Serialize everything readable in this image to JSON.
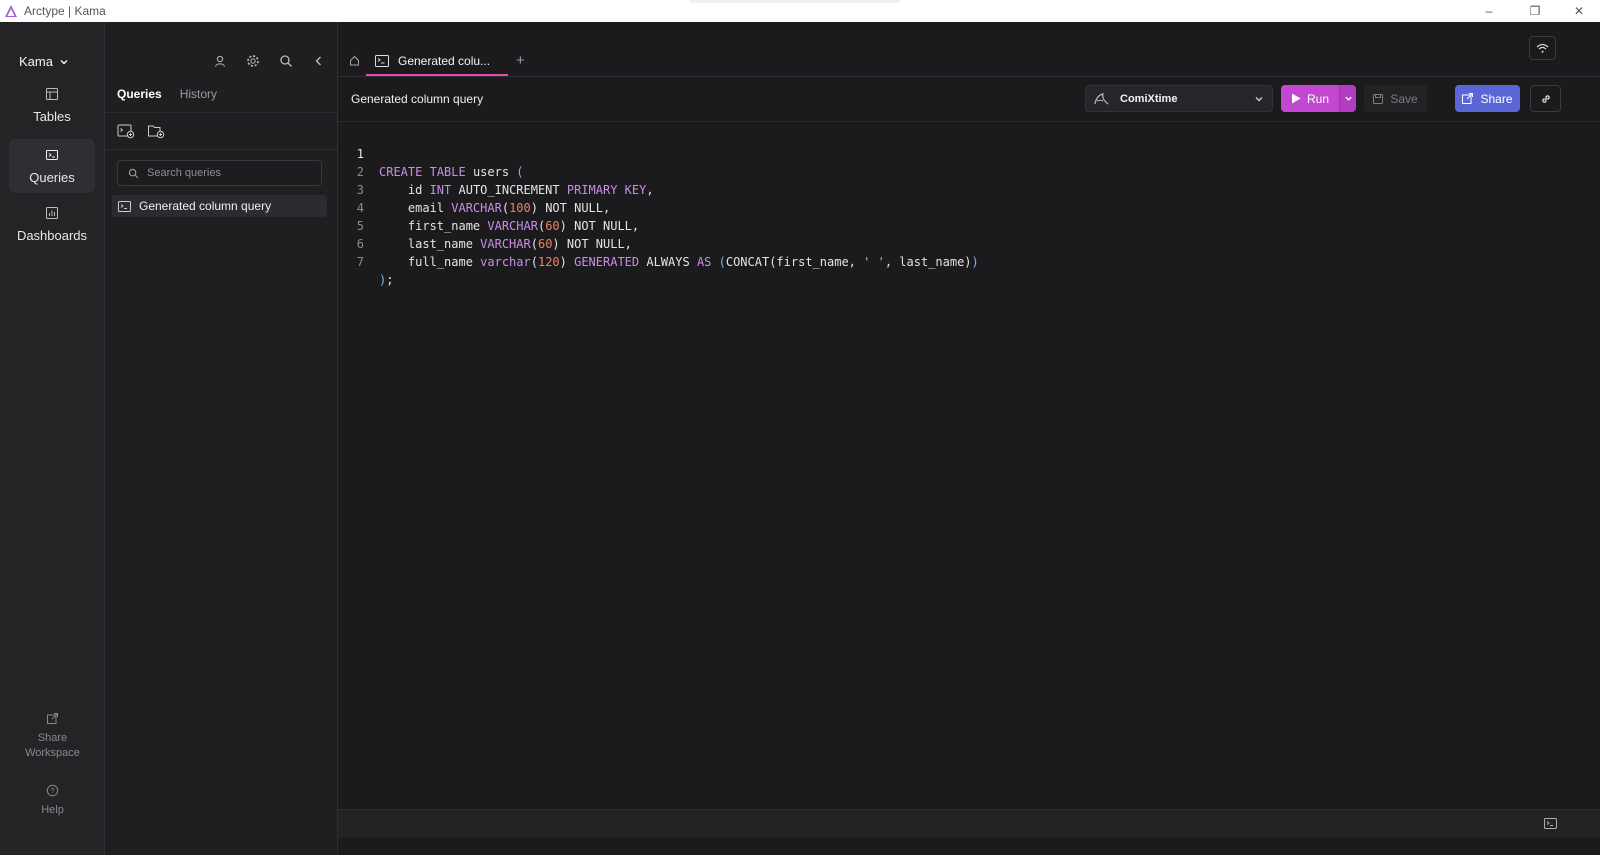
{
  "window": {
    "title": "Arctype | Kama",
    "controls": {
      "minimize": "–",
      "restore": "❐",
      "close": "✕"
    }
  },
  "workspace": {
    "name": "Kama"
  },
  "rail": {
    "items": [
      {
        "label": "Tables",
        "icon": "table-icon"
      },
      {
        "label": "Queries",
        "icon": "terminal-icon",
        "active": true
      },
      {
        "label": "Dashboards",
        "icon": "chart-icon"
      }
    ],
    "share_line1": "Share",
    "share_line2": "Workspace",
    "help": "Help"
  },
  "panel": {
    "tabs": [
      {
        "label": "Queries",
        "active": true
      },
      {
        "label": "History"
      }
    ],
    "search_placeholder": "Search queries",
    "queries": [
      {
        "label": "Generated column query"
      }
    ]
  },
  "tabs": {
    "open": [
      {
        "label": "Generated colu..."
      }
    ],
    "add": "+"
  },
  "toolbar": {
    "query_title": "Generated column query",
    "connection": "ComiXtime",
    "run_label": "Run",
    "save_label": "Save",
    "share_label": "Share"
  },
  "editor": {
    "current_line": 1,
    "lines": [
      "CREATE TABLE users (",
      "    id INT AUTO_INCREMENT PRIMARY KEY,",
      "    email VARCHAR(100) NOT NULL,",
      "    first_name VARCHAR(60) NOT NULL,",
      "    last_name VARCHAR(60) NOT NULL,",
      "    full_name varchar(120) GENERATED ALWAYS AS (CONCAT(first_name, ' ', last_name))",
      ");"
    ]
  },
  "colors": {
    "accent_run": "#c248d1",
    "accent_share": "#5b66d6",
    "tab_underline": "#ea4aaa",
    "keyword": "#c98de8",
    "number": "#f08060",
    "string": "#b7c86a"
  }
}
